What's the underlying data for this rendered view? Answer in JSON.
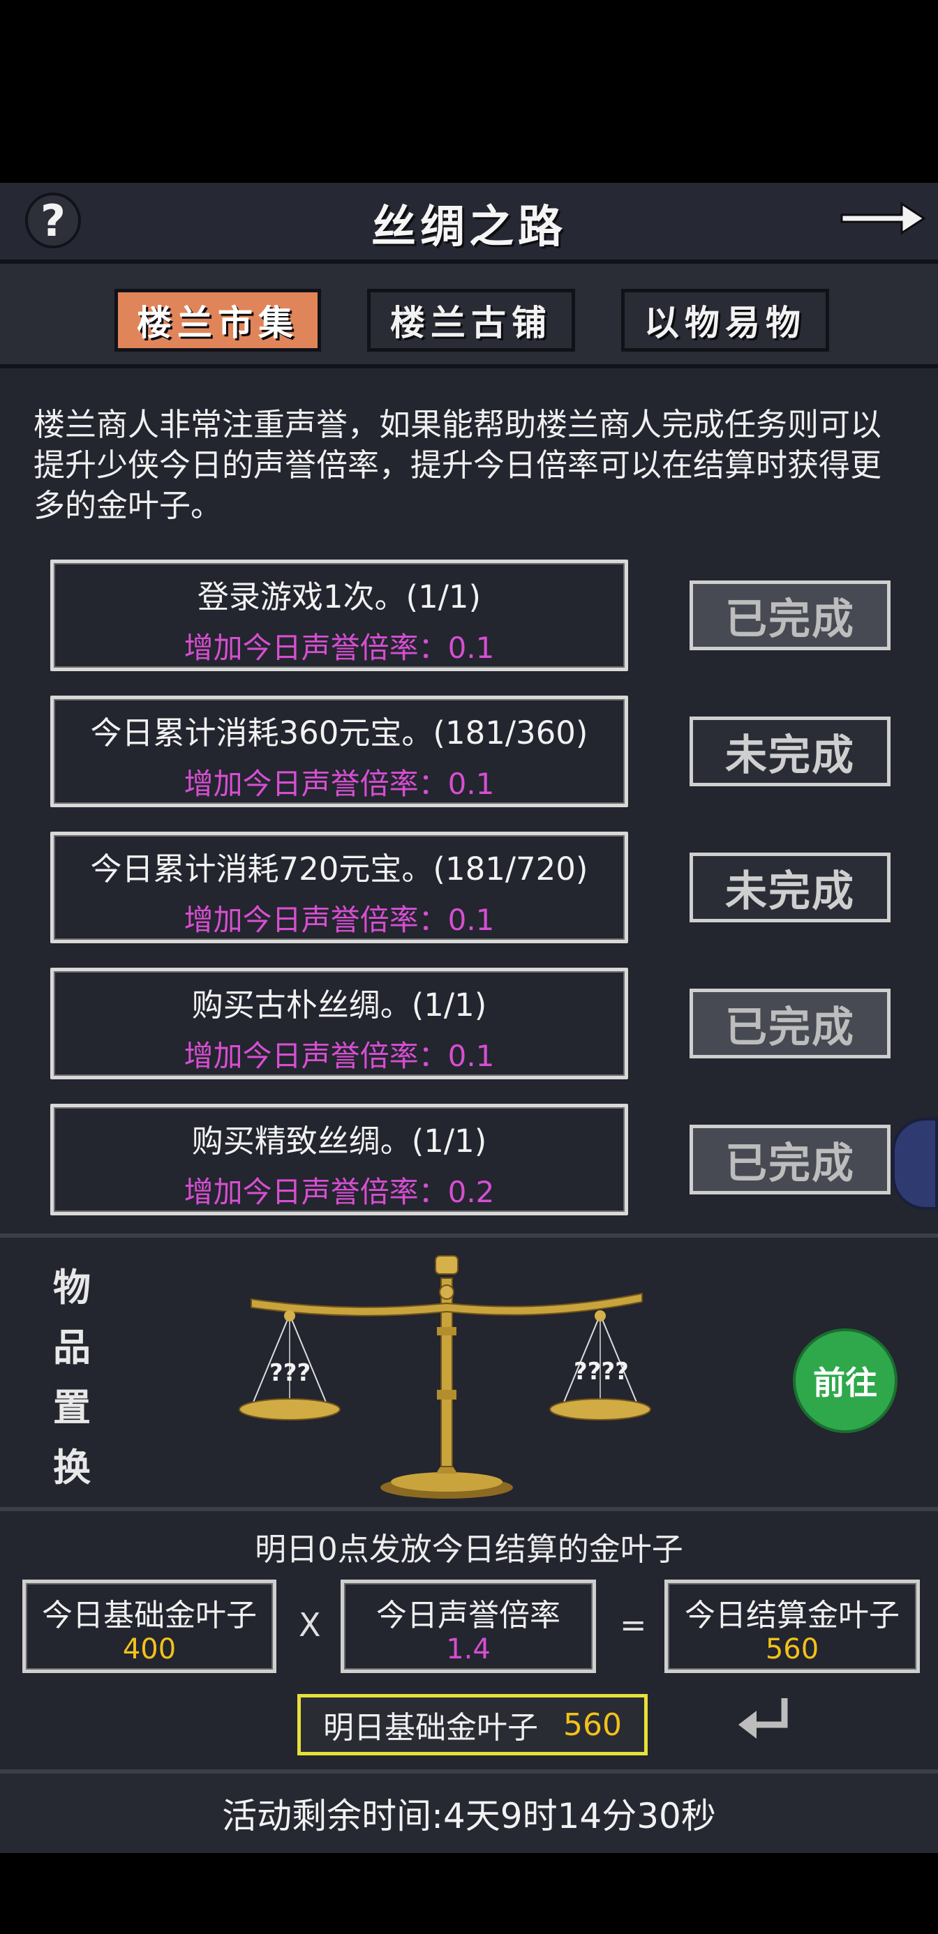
{
  "header": {
    "title": "丝绸之路",
    "help_icon": "question-icon",
    "next_icon": "arrow-right-icon"
  },
  "tabs": [
    {
      "label": "楼兰市集",
      "active": true
    },
    {
      "label": "楼兰古铺",
      "active": false
    },
    {
      "label": "以物易物",
      "active": false
    }
  ],
  "description": "楼兰商人非常注重声誉，如果能帮助楼兰商人完成任务则可以提升少侠今日的声誉倍率，提升今日倍率可以在结算时获得更多的金叶子。",
  "tasks": [
    {
      "title": "登录游戏1次。(1/1)",
      "reward": "增加今日声誉倍率：0.1",
      "status": "已完成"
    },
    {
      "title": "今日累计消耗360元宝。(181/360)",
      "reward": "增加今日声誉倍率：0.1",
      "status": "未完成"
    },
    {
      "title": "今日累计消耗720元宝。(181/720)",
      "reward": "增加今日声誉倍率：0.1",
      "status": "未完成"
    },
    {
      "title": "购买古朴丝绸。(1/1)",
      "reward": "增加今日声誉倍率：0.1",
      "status": "已完成"
    },
    {
      "title": "购买精致丝绸。(1/1)",
      "reward": "增加今日声誉倍率：0.2",
      "status": "已完成"
    }
  ],
  "trade": {
    "label_chars": [
      "物",
      "品",
      "置",
      "换"
    ],
    "left_pan": "???",
    "right_pan": "????",
    "go_button": "前往"
  },
  "settlement": {
    "title": "明日0点发放今日结算的金叶子",
    "base": {
      "label": "今日基础金叶子",
      "value": "400"
    },
    "multiply_op": "X",
    "rate": {
      "label": "今日声誉倍率",
      "value": "1.4"
    },
    "equals_op": "=",
    "result": {
      "label": "今日结算金叶子",
      "value": "560"
    },
    "tomorrow": {
      "label": "明日基础金叶子",
      "value": "560"
    }
  },
  "time_left": "活动剩余时间:4天9时14分30秒",
  "colors": {
    "tab_active": "#e0855a",
    "reward_text": "#d64fd0",
    "gold_value": "#f2c21a",
    "rate_value": "#d64fd0",
    "go_button": "#2ea84b",
    "tomorrow_border": "#e7e03a"
  }
}
